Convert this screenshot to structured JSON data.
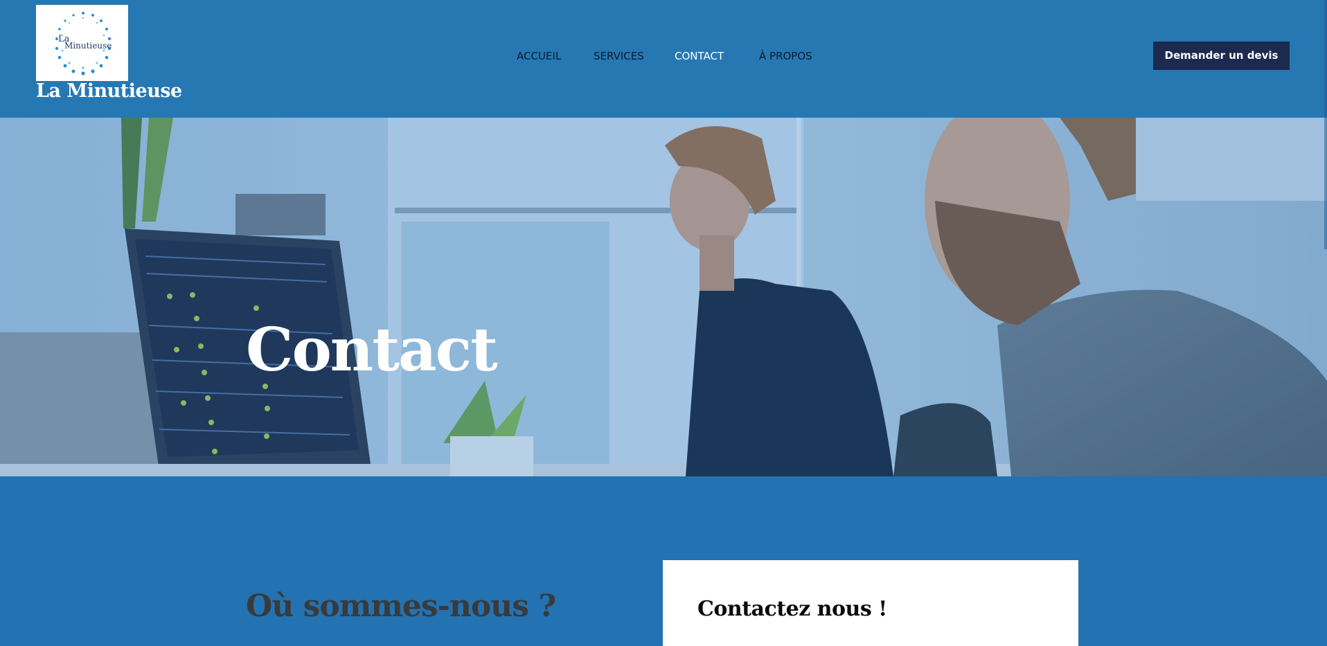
{
  "brand": {
    "name": "La Minutieuse",
    "logo_text_la": "La",
    "logo_text_name": "Minutieuse"
  },
  "nav": {
    "items": [
      {
        "label": "ACCUEIL",
        "active": false
      },
      {
        "label": "SERVICES",
        "active": false
      },
      {
        "label": "CONTACT",
        "active": true
      },
      {
        "label": "À PROPOS",
        "active": false
      }
    ]
  },
  "cta": {
    "label": "Demander un devis"
  },
  "hero": {
    "title": "Contact"
  },
  "section": {
    "title": "Où sommes-nous ?",
    "card_title": "Contactez nous !"
  },
  "colors": {
    "header_bg": "#2678b3",
    "page_bg": "#2372b2",
    "cta_bg": "#1b2a4e",
    "active_nav": "#ffffff",
    "nav_text": "#0b1a2b"
  }
}
